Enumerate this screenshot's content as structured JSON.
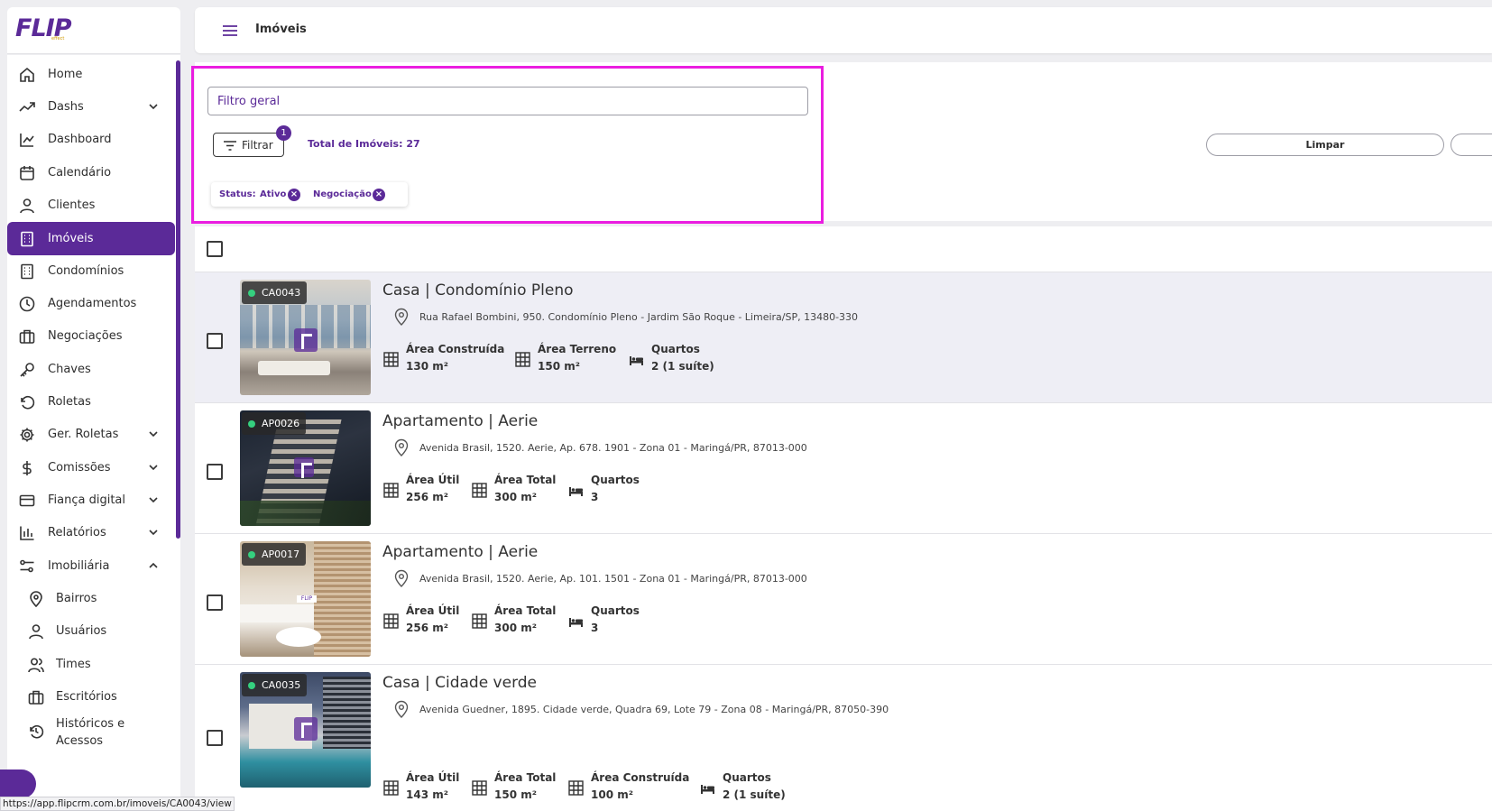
{
  "app": {
    "logo": "FLIP",
    "logo_sub": "effect",
    "page_title": "Imóveis",
    "status_url": "https://app.flipcrm.com.br/imoveis/CA0043/view"
  },
  "colors": {
    "brand": "#5b2a98",
    "highlight": "#ea1de0",
    "status_active": "#35d07f"
  },
  "sidebar": {
    "items": [
      {
        "label": "Home",
        "icon": "home-icon"
      },
      {
        "label": "Dashs",
        "icon": "trending-up-icon",
        "expand": "down"
      },
      {
        "label": "Dashboard",
        "icon": "line-chart-icon"
      },
      {
        "label": "Calendário",
        "icon": "calendar-icon"
      },
      {
        "label": "Clientes",
        "icon": "user-icon"
      },
      {
        "label": "Imóveis",
        "icon": "building-icon",
        "active": true
      },
      {
        "label": "Condomínios",
        "icon": "building-icon"
      },
      {
        "label": "Agendamentos",
        "icon": "clock-icon"
      },
      {
        "label": "Negociações",
        "icon": "briefcase-icon"
      },
      {
        "label": "Chaves",
        "icon": "key-icon"
      },
      {
        "label": "Roletas",
        "icon": "rotate-icon"
      },
      {
        "label": "Ger. Roletas",
        "icon": "gear-icon",
        "expand": "down"
      },
      {
        "label": "Comissões",
        "icon": "dollar-icon",
        "expand": "down"
      },
      {
        "label": "Fiança digital",
        "icon": "card-icon",
        "expand": "down"
      },
      {
        "label": "Relatórios",
        "icon": "bar-chart-icon",
        "expand": "down"
      },
      {
        "label": "Imobiliária",
        "icon": "sliders-icon",
        "expand": "up"
      },
      {
        "label": "Bairros",
        "icon": "pin-icon",
        "sub": true
      },
      {
        "label": "Usuários",
        "icon": "user-icon",
        "sub": true
      },
      {
        "label": "Times",
        "icon": "users-icon",
        "sub": true
      },
      {
        "label": "Escritórios",
        "icon": "briefcase-icon",
        "sub": true
      },
      {
        "label": "Históricos e Acessos",
        "icon": "history-icon",
        "sub": true
      }
    ]
  },
  "filters": {
    "search_placeholder": "Filtro geral",
    "filter_button": "Filtrar",
    "filter_count": "1",
    "total_label": "Total de Imóveis: 27",
    "chip_key": "Status:",
    "chips": [
      "Ativo",
      "Negociação"
    ],
    "clear_button": "Limpar"
  },
  "listings": [
    {
      "code": "CA0043",
      "title": "Casa | Condomínio Pleno",
      "address": "Rua Rafael Bombini, 950. Condomínio Pleno - Jardim São Roque - Limeira/SP, 13480-330",
      "specs": [
        {
          "label": "Área Construída",
          "value": "130 m²",
          "icon": "grid-icon"
        },
        {
          "label": "Área Terreno",
          "value": "150 m²",
          "icon": "grid-icon"
        },
        {
          "label": "Quartos",
          "value": "2 (1 suíte)",
          "icon": "bed-icon"
        }
      ]
    },
    {
      "code": "AP0026",
      "title": "Apartamento | Aerie",
      "address": "Avenida Brasil, 1520. Aerie, Ap. 678. 1901 - Zona 01 - Maringá/PR, 87013-000",
      "specs": [
        {
          "label": "Área Útil",
          "value": "256 m²",
          "icon": "grid-icon"
        },
        {
          "label": "Área Total",
          "value": "300 m²",
          "icon": "grid-icon"
        },
        {
          "label": "Quartos",
          "value": "3",
          "icon": "bed-icon"
        }
      ]
    },
    {
      "code": "AP0017",
      "title": "Apartamento | Aerie",
      "address": "Avenida Brasil, 1520. Aerie, Ap. 101. 1501 - Zona 01 - Maringá/PR, 87013-000",
      "specs": [
        {
          "label": "Área Útil",
          "value": "256 m²",
          "icon": "grid-icon"
        },
        {
          "label": "Área Total",
          "value": "300 m²",
          "icon": "grid-icon"
        },
        {
          "label": "Quartos",
          "value": "3",
          "icon": "bed-icon"
        }
      ]
    },
    {
      "code": "CA0035",
      "title": "Casa | Cidade verde",
      "address": "Avenida Guedner, 1895. Cidade verde, Quadra 69, Lote 79 - Zona 08 - Maringá/PR, 87050-390",
      "specs": [
        {
          "label": "Área Útil",
          "value": "143 m²",
          "icon": "grid-icon"
        },
        {
          "label": "Área Total",
          "value": "150 m²",
          "icon": "grid-icon"
        },
        {
          "label": "Área Construída",
          "value": "100 m²",
          "icon": "grid-icon"
        },
        {
          "label": "Quartos",
          "value": "2 (1 suíte)",
          "icon": "bed-icon"
        }
      ]
    }
  ]
}
